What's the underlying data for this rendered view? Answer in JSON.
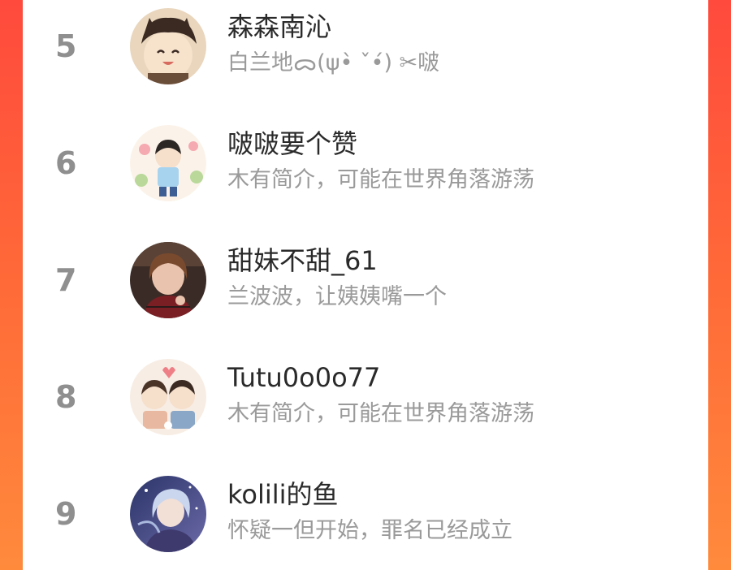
{
  "ranking": {
    "entries": [
      {
        "rank": "5",
        "name": "森森南沁",
        "bio": "白兰地ᯅ(ψ•̀ ˇ•́) ✂啵"
      },
      {
        "rank": "6",
        "name": "啵啵要个赞",
        "bio": "木有简介，可能在世界角落游荡"
      },
      {
        "rank": "7",
        "name": "甜妹不甜_61",
        "bio": "兰波波，让姨姨嘴一个"
      },
      {
        "rank": "8",
        "name": "Tutu0o0o77",
        "bio": "木有简介，可能在世界角落游荡"
      },
      {
        "rank": "9",
        "name": "kolili的鱼",
        "bio": "怀疑一但开始，罪名已经成立"
      }
    ]
  },
  "colors": {
    "background_top": "#ff4a3d",
    "background_bottom": "#ff8a3c",
    "card": "#ffffff",
    "rank_text": "#8f8f8f",
    "name_text": "#2a2a2a",
    "bio_text": "#9a9a9a"
  }
}
